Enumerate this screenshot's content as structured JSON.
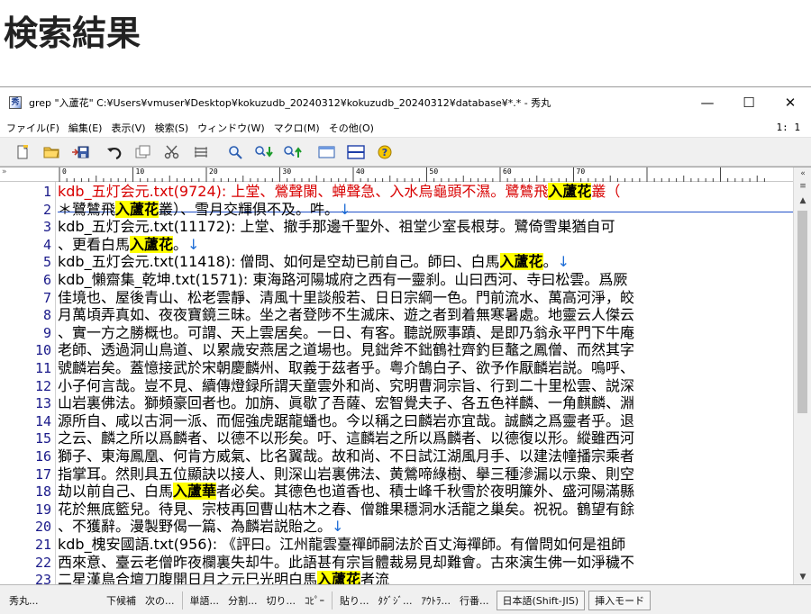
{
  "page": {
    "heading": "検索結果"
  },
  "window": {
    "title": "grep \"入蘆花\" C:¥Users¥vmuser¥Desktop¥kokuzudb_20240312¥kokuzudb_20240312¥database¥*.* - 秀丸",
    "minimize_glyph": "—",
    "maximize_glyph": "☐",
    "close_glyph": "✕"
  },
  "menu": {
    "items": [
      "ファイル(F)",
      "編集(E)",
      "表示(V)",
      "検索(S)",
      "ウィンドウ(W)",
      "マクロ(M)",
      "その他(O)"
    ],
    "position": "1: 1"
  },
  "toolbar": {
    "buttons": [
      {
        "name": "new-file-icon",
        "glyph": "🗎"
      },
      {
        "name": "open-folder-icon",
        "glyph": "📂"
      },
      {
        "name": "save-icon",
        "glyph": "💾"
      },
      {
        "name": "undo-icon",
        "glyph": "↶"
      },
      {
        "name": "copy-icon",
        "glyph": "⧉"
      },
      {
        "name": "cut-icon",
        "glyph": "✂"
      },
      {
        "name": "paste-icon",
        "glyph": "≣"
      },
      {
        "name": "search-icon",
        "glyph": "🔍"
      },
      {
        "name": "search-next-icon",
        "glyph": "🔍↓"
      },
      {
        "name": "search-prev-icon",
        "glyph": "🔍↑"
      },
      {
        "name": "window-icon",
        "glyph": "▭"
      },
      {
        "name": "split-icon",
        "glyph": "⊟"
      },
      {
        "name": "help-icon",
        "glyph": "?"
      }
    ]
  },
  "ruler": {
    "marks": [
      "0",
      "10",
      "20",
      "30",
      "40",
      "50",
      "60",
      "70"
    ]
  },
  "editor": {
    "lines": [
      {
        "num": "1",
        "segments": [
          {
            "t": "kdb_五灯会元.txt(9724):   上堂、鶯聲闌、蝉聲急、入水烏龜頭不濕。鷺鷥飛"
          },
          {
            "t": "入蘆花",
            "hl": true
          },
          {
            "t": "叢（"
          }
        ]
      },
      {
        "num": "2",
        "segments": [
          {
            "t": "＊鷺鷥飛"
          },
          {
            "t": "入蘆花",
            "hl": true
          },
          {
            "t": "叢）、雪月交輝俱不及。吽。"
          },
          {
            "t": "↓",
            "nl": true
          }
        ]
      },
      {
        "num": "3",
        "segments": [
          {
            "t": "kdb_五灯会元.txt(11172):   上堂、撤手那邊千聖外、祖堂少室長根芽。鷺倚雪巣猶自可"
          }
        ]
      },
      {
        "num": "4",
        "segments": [
          {
            "t": "、更看白馬"
          },
          {
            "t": "入蘆花",
            "hl": true
          },
          {
            "t": "。"
          },
          {
            "t": "↓",
            "nl": true
          }
        ]
      },
      {
        "num": "5",
        "segments": [
          {
            "t": "kdb_五灯会元.txt(11418):   僧問、如何是空劫已前自己。師曰、白馬"
          },
          {
            "t": "入蘆花",
            "hl": true
          },
          {
            "t": "。"
          },
          {
            "t": "↓",
            "nl": true
          }
        ]
      },
      {
        "num": "6",
        "segments": [
          {
            "t": "kdb_懶齋集_乾坤.txt(1571): 東海路河陽城府之西有一靈刹。山曰西河、寺曰松雲。爲厥"
          }
        ]
      },
      {
        "num": "7",
        "segments": [
          {
            "t": "佳境也、屋後青山、松老雲靜、清風十里談般若、日日宗綱一色。門前流水、萬高河淨，皎"
          }
        ]
      },
      {
        "num": "8",
        "segments": [
          {
            "t": "月萬頃弄真如、夜夜寶鏡三昧。坐之者登陟不生滅床、遊之者到着無寒暑處。地靈云人傑云"
          }
        ]
      },
      {
        "num": "9",
        "segments": [
          {
            "t": "、實一方之勝概也。可謂、天上雲居矣。一日、有客。聽説厥事蹟、是即乃翁永平門下牛庵"
          }
        ]
      },
      {
        "num": "10",
        "segments": [
          {
            "t": "老師、透過洞山鳥道、以累歳安燕居之道場也。見鈯斧不鈯鶴社齊釣巨鼇之鳳僧、而然其字"
          }
        ]
      },
      {
        "num": "11",
        "segments": [
          {
            "t": "號麟岩矣。蓋憶接武於宋朝慶麟州、取義于茲者乎。粤介鵠白子、欲予作厭麟岩説。嗚呼、"
          }
        ]
      },
      {
        "num": "12",
        "segments": [
          {
            "t": "小子何言哉。豈不見、續傳燈録所謂天童雲外和尚、究明曹洞宗旨、行到二十里松雲、説深"
          }
        ]
      },
      {
        "num": "13",
        "segments": [
          {
            "t": "山岩裏佛法。獅頻豪回者也。加旃、眞歇了吾薩、宏智覺夫子、各五色祥麟、一角麒麟、淵"
          }
        ]
      },
      {
        "num": "14",
        "segments": [
          {
            "t": "源所自、咸以古洞一派、而倔強虎踞龍蟠也。今以稱之曰麟岩亦宜哉。誠麟之爲靈者乎。退"
          }
        ]
      },
      {
        "num": "15",
        "segments": [
          {
            "t": "之云、麟之所以爲麟者、以德不以形矣。吁、這麟岩之所以爲麟者、以德復以形。縱雖西河"
          }
        ]
      },
      {
        "num": "16",
        "segments": [
          {
            "t": "獅子、東海鳳凰、何肯方威氣、比名翼哉。故和尚、不日試江湖風月手、以建法幢播宗乘者"
          }
        ]
      },
      {
        "num": "17",
        "segments": [
          {
            "t": "指掌耳。然則具五位顯訣以接人、則深山岩裏佛法、黄鶯啼綠樹、擧三種滲漏以示衆、則空"
          }
        ]
      },
      {
        "num": "18",
        "segments": [
          {
            "t": "劫以前自己、白馬"
          },
          {
            "t": "入蘆華",
            "hl": true
          },
          {
            "t": "者必矣。其德色也道香也、積士峰千秋雪於夜明簾外、盛河陽滿縣"
          }
        ]
      },
      {
        "num": "19",
        "segments": [
          {
            "t": "花於無底籃兒。待見、宗枝再回曹山枯木之春、僧雛果穩洞水活龍之巢矣。祝祝。鶴望有餘"
          }
        ]
      },
      {
        "num": "20",
        "segments": [
          {
            "t": "、不獲辭。漫製野偈一篇、為麟岩説貽之。"
          },
          {
            "t": "↓",
            "nl": true
          }
        ]
      },
      {
        "num": "21",
        "segments": [
          {
            "t": "kdb_槐安國語.txt(956):  《評曰。江州龍雲臺禪師嗣法於百丈海禪師。有僧問如何是祖師"
          }
        ]
      },
      {
        "num": "22",
        "segments": [
          {
            "t": "西來意、臺云老僧昨夜欄裏失却牛。此語甚有宗旨體裁易見却難會。古來演生佛一如淨穢不"
          }
        ]
      },
      {
        "num": "23",
        "segments": [
          {
            "t": "二星漢鳥合壇刀腹開日月之元巳光明白馬"
          },
          {
            "t": "入蘆花",
            "hl": true
          },
          {
            "t": "者流"
          }
        ]
      }
    ]
  },
  "statusbar": {
    "app": "秀丸...",
    "items": [
      "下候補",
      "次の...",
      "単語...",
      "分割...",
      "切り...",
      "ｺﾋﾟｰ",
      "貼り...",
      "ﾀｸﾞｼﾞ...",
      "ｱｳﾄﾗ...",
      "行番..."
    ],
    "encoding": "日本語(Shift-JIS)",
    "mode": "挿入モード"
  }
}
